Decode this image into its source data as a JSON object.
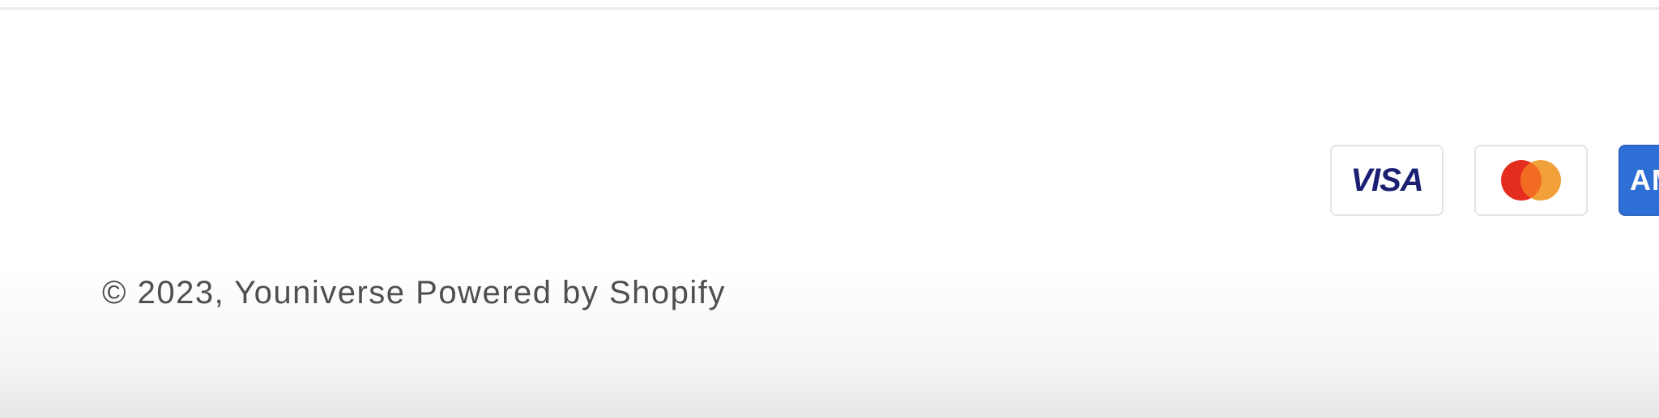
{
  "footer": {
    "copyright": "© 2023, Youniverse Powered by Shopify",
    "payment_methods": [
      {
        "name": "Visa",
        "label": "VISA",
        "icon": "visa-icon",
        "color": "#1a1f71"
      },
      {
        "name": "Mastercard",
        "label": "",
        "icon": "mastercard-icon",
        "colors": [
          "#eb001b",
          "#f79e1b"
        ]
      },
      {
        "name": "American Express",
        "label": "AMEX",
        "icon": "amex-icon",
        "color": "#2e6fd6"
      }
    ]
  }
}
